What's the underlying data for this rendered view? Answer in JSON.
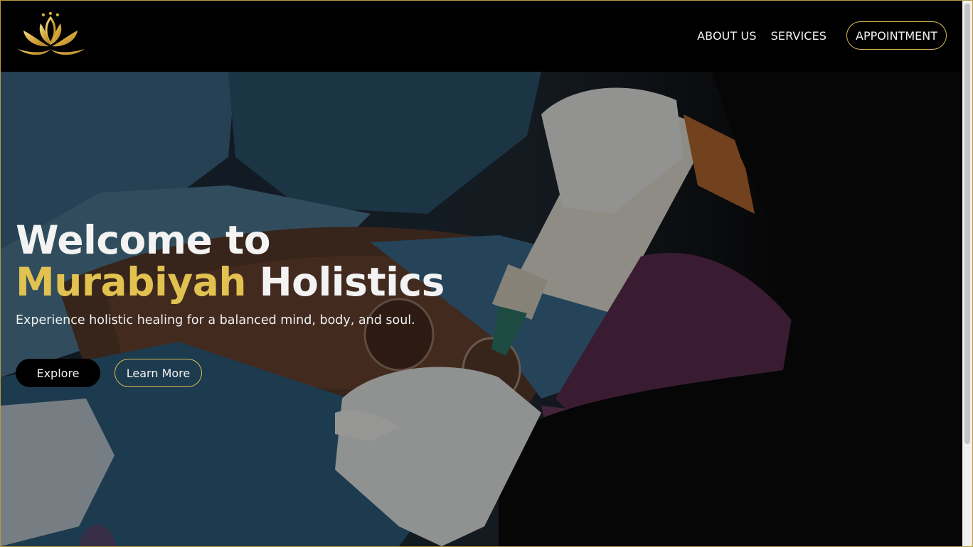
{
  "header": {
    "logo_name": "lotus-logo",
    "nav": [
      {
        "label": "ABOUT US"
      },
      {
        "label": "SERVICES"
      }
    ],
    "cta_label": "APPOINTMENT"
  },
  "hero": {
    "title_line1": "Welcome to",
    "title_highlight": "Murabiyah",
    "title_rest": " Holistics",
    "subtitle": "Experience holistic healing for a balanced mind, body, and soul.",
    "primary_button": "Explore",
    "secondary_button": "Learn More",
    "background_image": "cupping-therapy-photo"
  },
  "colors": {
    "accent_gold": "#e1c150",
    "background": "#000000",
    "text": "#f2f2f2"
  }
}
